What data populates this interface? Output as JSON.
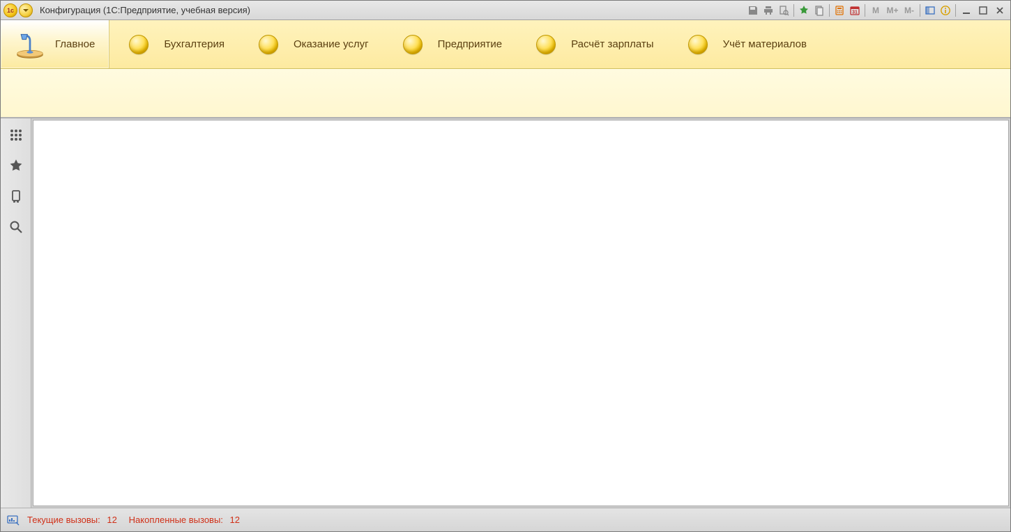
{
  "titlebar": {
    "app_code": "1c",
    "title": "Конфигурация  (1С:Предприятие, учебная версия)",
    "memory_buttons": [
      "M",
      "M+",
      "M-"
    ]
  },
  "nav": {
    "items": [
      {
        "label": "Главное",
        "active": true
      },
      {
        "label": "Бухгалтерия",
        "active": false
      },
      {
        "label": "Оказание услуг",
        "active": false
      },
      {
        "label": "Предприятие",
        "active": false
      },
      {
        "label": "Расчёт зарплаты",
        "active": false
      },
      {
        "label": "Учёт материалов",
        "active": false
      }
    ]
  },
  "statusbar": {
    "current_calls_label": "Текущие вызовы:",
    "current_calls_value": "12",
    "accumulated_calls_label": "Накопленные вызовы:",
    "accumulated_calls_value": "12"
  }
}
